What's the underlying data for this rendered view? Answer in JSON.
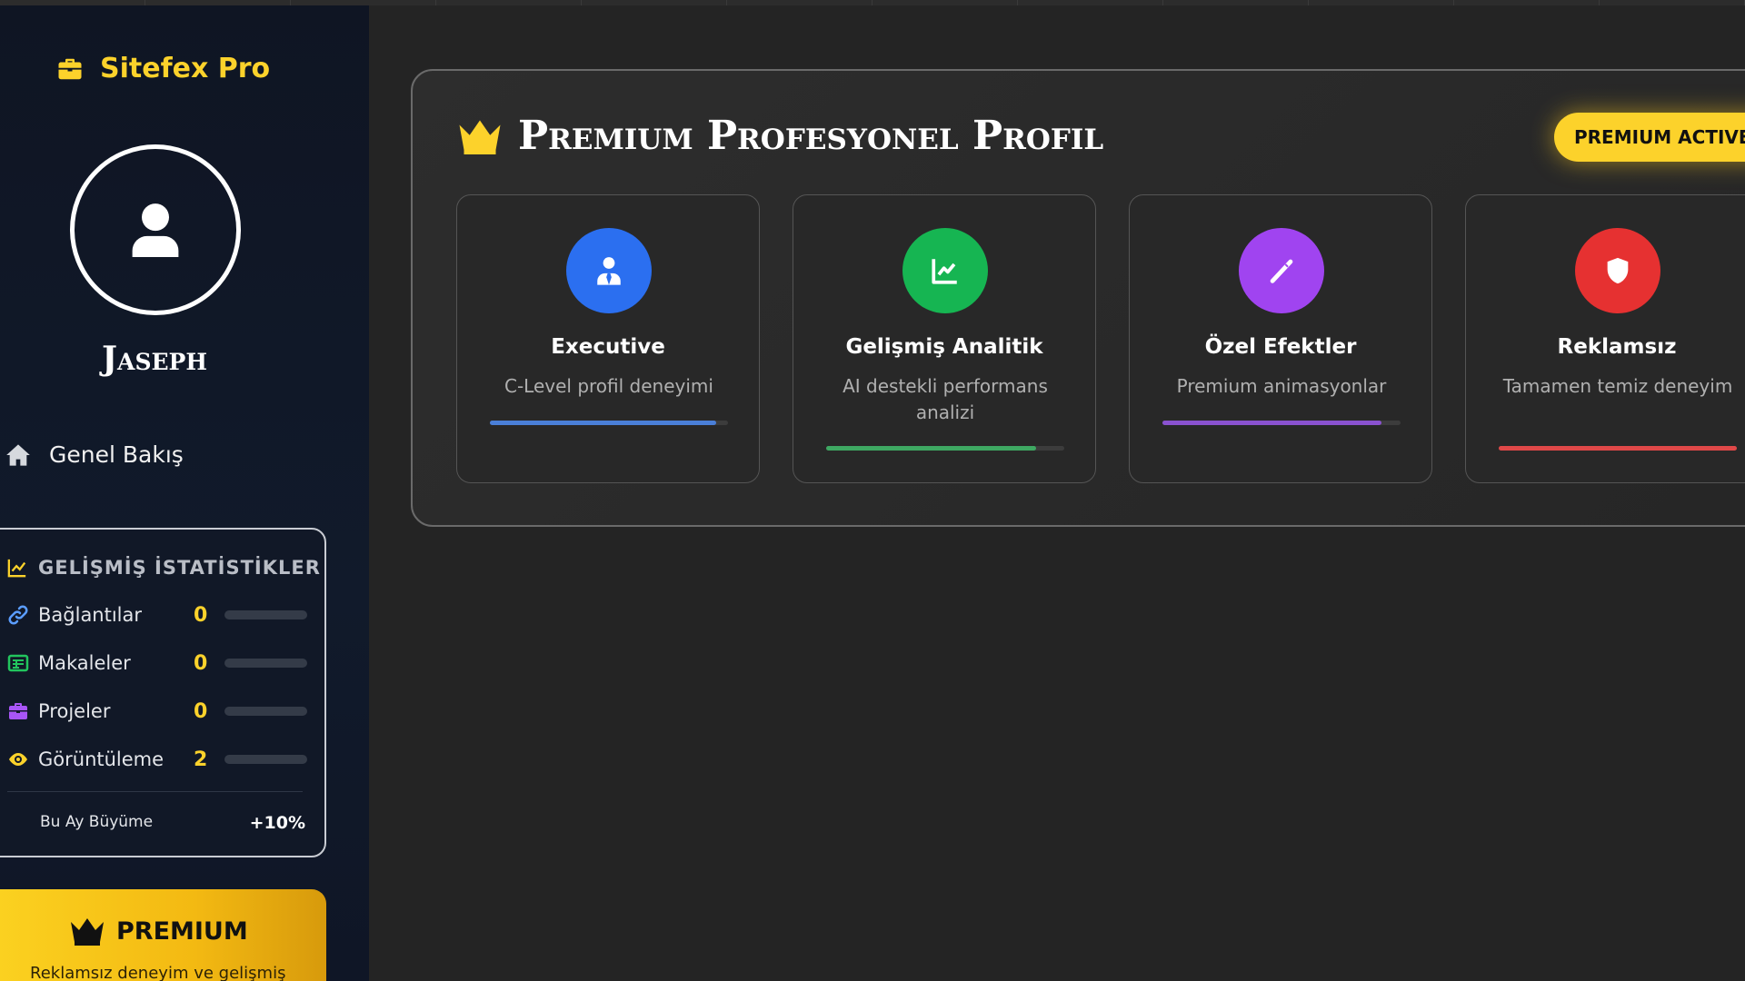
{
  "brand": {
    "name": "Sitefex Pro",
    "icon": "briefcase-icon"
  },
  "user": {
    "name": "Jaseph"
  },
  "nav": {
    "overview_label": "Genel Bakış"
  },
  "stats": {
    "title": "GELİŞMİŞ İSTATİSTİKLER",
    "rows": [
      {
        "label": "Bağlantılar",
        "value": "0",
        "icon": "link-icon",
        "color": "#5b9dff"
      },
      {
        "label": "Makaleler",
        "value": "0",
        "icon": "newspaper-icon",
        "color": "#22c55e"
      },
      {
        "label": "Projeler",
        "value": "0",
        "icon": "briefcase-icon",
        "color": "#a855f7"
      },
      {
        "label": "Görüntüleme",
        "value": "2",
        "icon": "eye-icon",
        "color": "#fcd22b"
      }
    ],
    "growth_label": "Bu Ay Büyüme",
    "growth_value": "+10%"
  },
  "premium": {
    "title": "PREMIUM",
    "description": "Reklamsız deneyim ve gelişmiş"
  },
  "panel": {
    "title": "Premium Profesyonel Profil",
    "badge": "PREMIUM ACTIVE",
    "features": [
      {
        "title": "Executive",
        "description": "C-Level profil deneyimi",
        "icon": "executive-icon",
        "color": "#2b6ff0",
        "bar_color": "#4a7fd8",
        "progress": 0.95
      },
      {
        "title": "Gelişmiş Analitik",
        "description": "AI destekli performans analizi",
        "icon": "chart-line-icon",
        "color": "#16b552",
        "bar_color": "#3ea862",
        "progress": 0.88
      },
      {
        "title": "Özel Efektler",
        "description": "Premium animasyonlar",
        "icon": "magic-wand-icon",
        "color": "#a044f0",
        "bar_color": "#8a52d0",
        "progress": 0.92
      },
      {
        "title": "Reklamsız",
        "description": "Tamamen temiz deneyim",
        "icon": "shield-icon",
        "color": "#e63131",
        "bar_color": "#e04848",
        "progress": 1.0
      }
    ]
  },
  "colors": {
    "accent": "#fcd22b",
    "sidebar": "#0f1523",
    "background": "#242424"
  }
}
